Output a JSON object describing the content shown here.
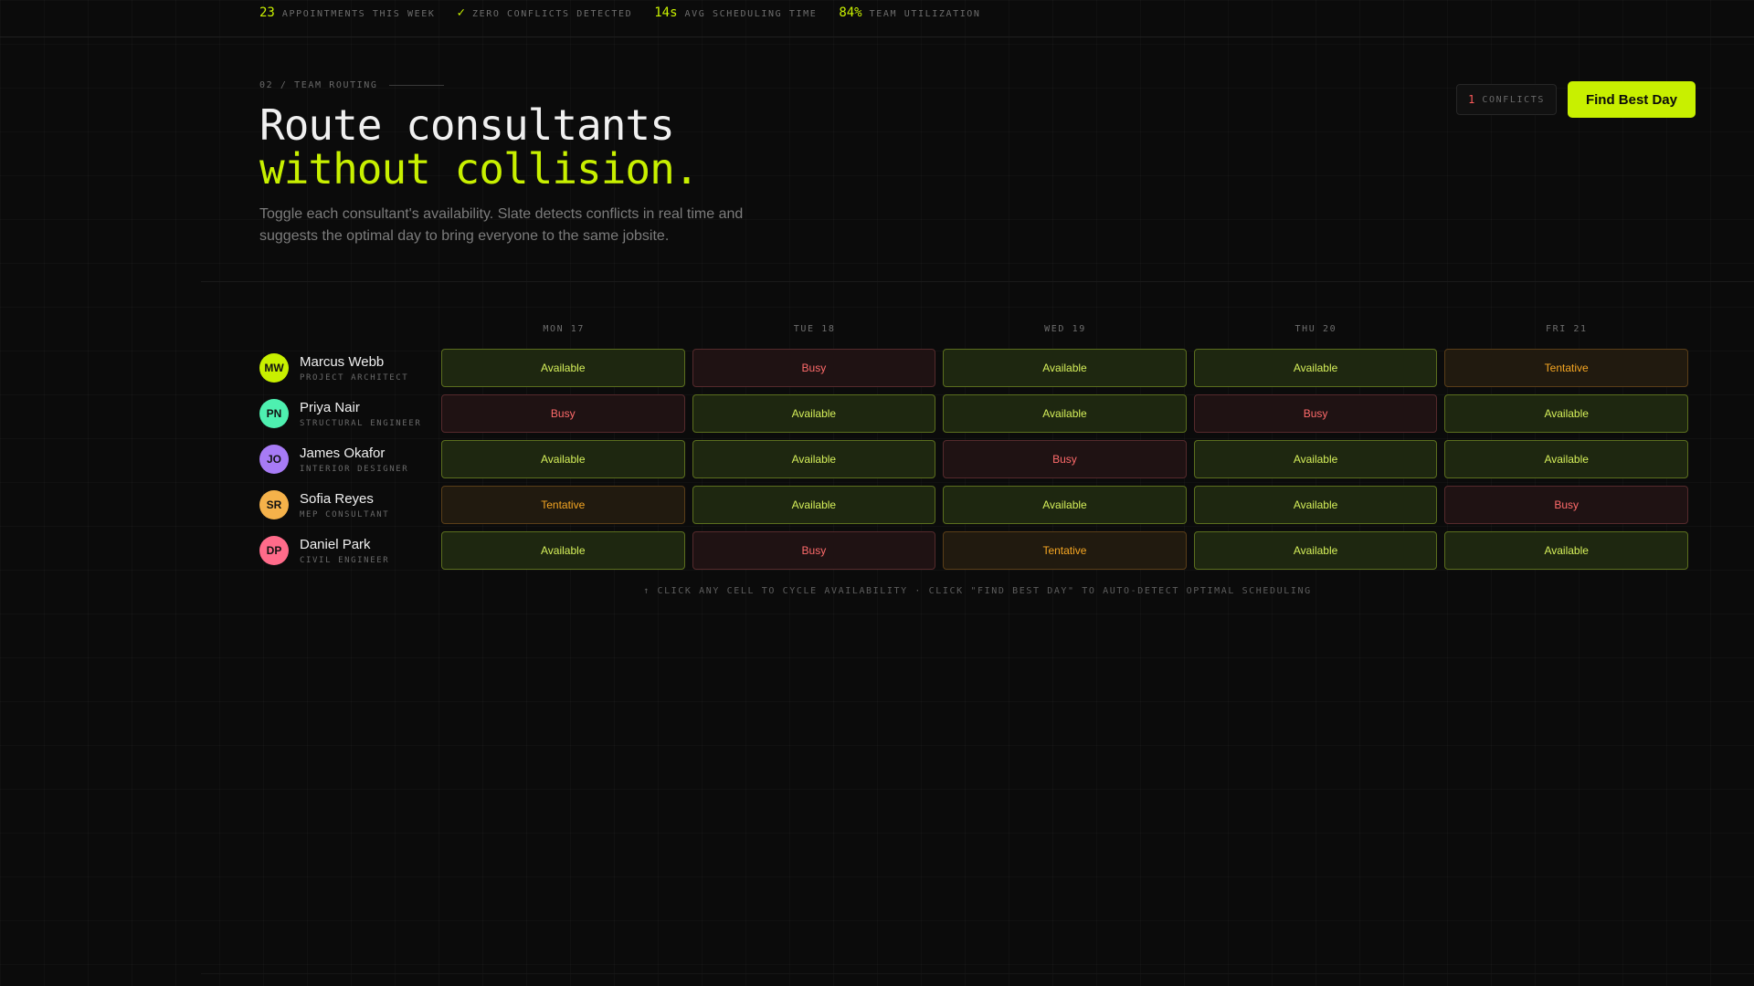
{
  "stats": [
    {
      "value": "23",
      "label": "APPOINTMENTS THIS WEEK"
    },
    {
      "value": "✓",
      "label": "ZERO CONFLICTS DETECTED"
    },
    {
      "value": "14s",
      "label": "AVG SCHEDULING TIME"
    },
    {
      "value": "84%",
      "label": "TEAM UTILIZATION"
    }
  ],
  "header": {
    "eyebrow": "02 / TEAM ROUTING",
    "title_line1": "Route consultants",
    "title_line2": "without collision.",
    "subtitle": "Toggle each consultant's availability. Slate detects conflicts in real time and suggests the optimal day to bring everyone to the same jobsite."
  },
  "actions": {
    "conflicts_count": "1",
    "conflicts_label": "CONFLICTS",
    "find_button": "Find Best Day"
  },
  "days": [
    "MON 17",
    "TUE 18",
    "WED 19",
    "THU 20",
    "FRI 21"
  ],
  "people": [
    {
      "initials": "MW",
      "name": "Marcus Webb",
      "role": "PROJECT ARCHITECT",
      "color": "#c8f000",
      "cells": [
        "Available",
        "Busy",
        "Available",
        "Available",
        "Tentative"
      ]
    },
    {
      "initials": "PN",
      "name": "Priya Nair",
      "role": "STRUCTURAL ENGINEER",
      "color": "#4ef0b0",
      "cells": [
        "Busy",
        "Available",
        "Available",
        "Busy",
        "Available"
      ]
    },
    {
      "initials": "JO",
      "name": "James Okafor",
      "role": "INTERIOR DESIGNER",
      "color": "#a77bf5",
      "cells": [
        "Available",
        "Available",
        "Busy",
        "Available",
        "Available"
      ]
    },
    {
      "initials": "SR",
      "name": "Sofia Reyes",
      "role": "MEP CONSULTANT",
      "color": "#f5b24a",
      "cells": [
        "Tentative",
        "Available",
        "Available",
        "Available",
        "Busy"
      ]
    },
    {
      "initials": "DP",
      "name": "Daniel Park",
      "role": "CIVIL ENGINEER",
      "color": "#ff6b8a",
      "cells": [
        "Available",
        "Busy",
        "Tentative",
        "Available",
        "Available"
      ]
    }
  ],
  "hint": "↑ CLICK ANY CELL TO CYCLE AVAILABILITY · CLICK \"FIND BEST DAY\" TO AUTO-DETECT OPTIMAL SCHEDULING"
}
